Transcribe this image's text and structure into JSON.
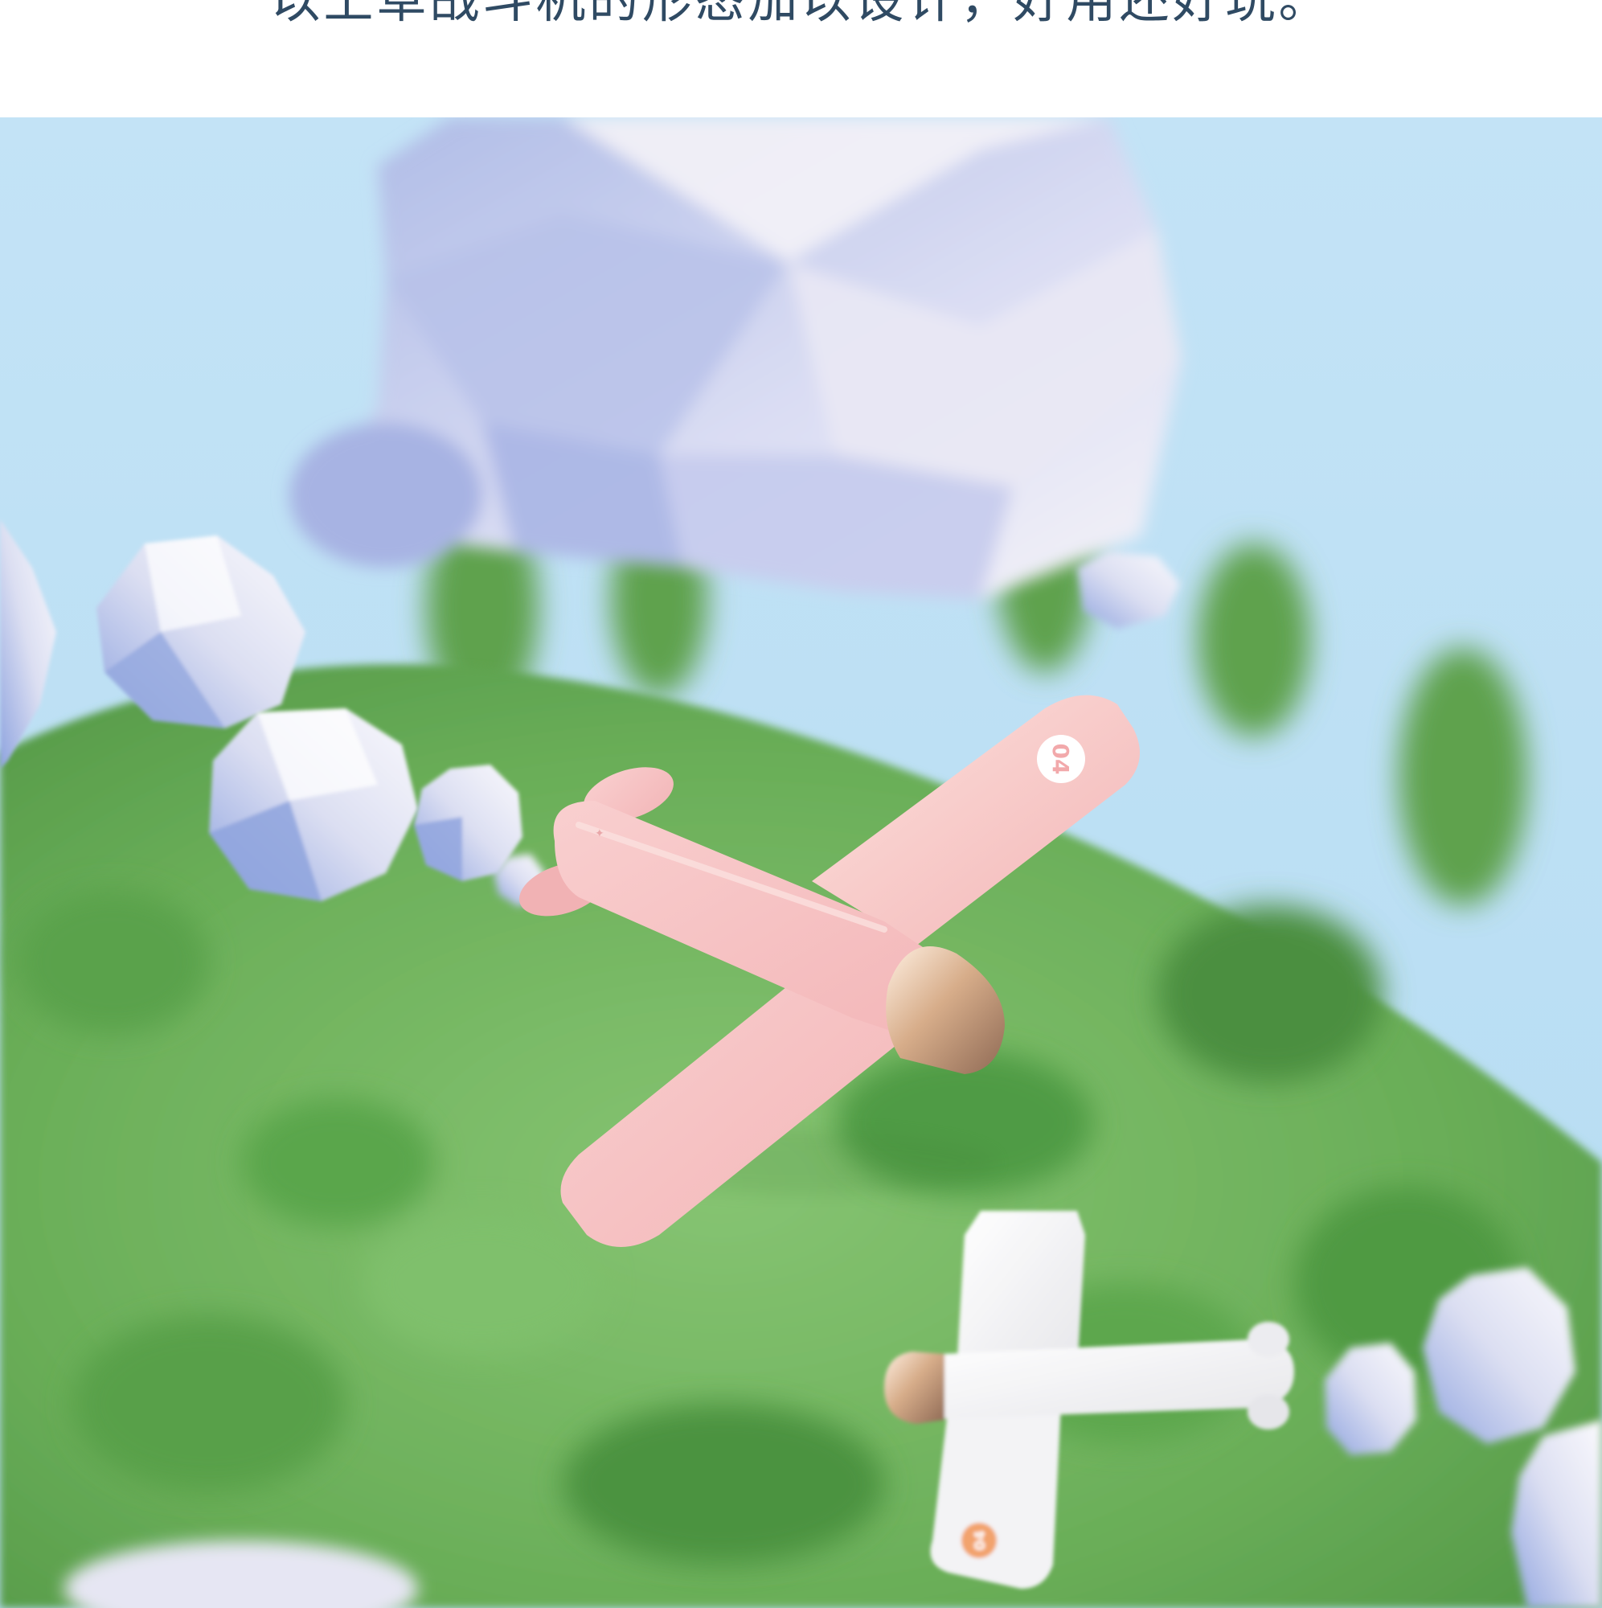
{
  "caption": {
    "text": "以上草战斗机的形态加以设计，好用还好玩。"
  },
  "scene": {
    "main_plane_badge": "04",
    "small_plane_badge": "04",
    "colors": {
      "sky": "#bfe2f5",
      "hill": "#6eb35c",
      "plane_pink": "#f7c4c4",
      "plane_white": "#f6f6f6",
      "nose_gold": "#c89a78",
      "caption_text": "#2f4a63"
    }
  }
}
